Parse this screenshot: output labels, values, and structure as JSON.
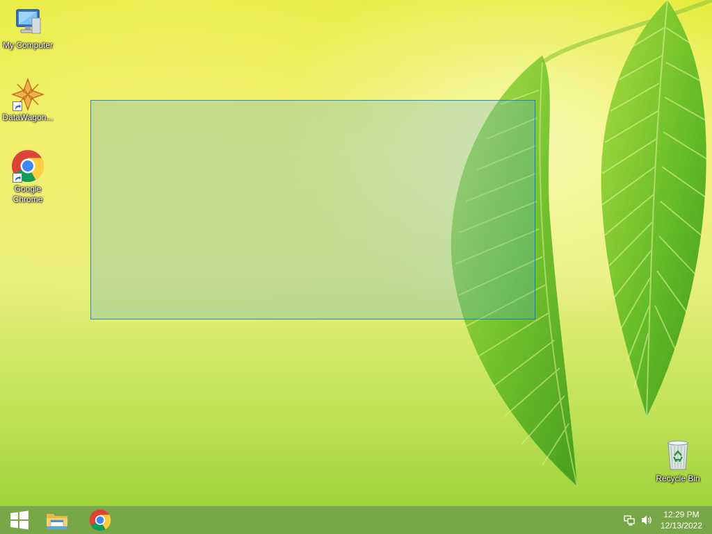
{
  "desktop": {
    "icons": [
      {
        "label": "My Computer",
        "icon": "computer-icon"
      },
      {
        "label": "DataWagon...",
        "icon": "datawagon-icon"
      },
      {
        "label": "Google Chrome",
        "icon": "chrome-icon"
      },
      {
        "label": "Recycle Bin",
        "icon": "recycle-bin-icon"
      }
    ],
    "selection_rectangle": true,
    "wallpaper": "green-leaves",
    "colors": {
      "accent": "#6ca038",
      "selection": "#5aaad2"
    }
  },
  "taskbar": {
    "start_icon": "windows-logo-icon",
    "pinned": [
      {
        "name": "File Explorer",
        "icon": "file-explorer-icon"
      },
      {
        "name": "Google Chrome",
        "icon": "chrome-icon"
      }
    ],
    "tray": {
      "icons": [
        "network-icon",
        "volume-icon"
      ],
      "time": "12:29 PM",
      "date": "12/13/2022"
    }
  }
}
